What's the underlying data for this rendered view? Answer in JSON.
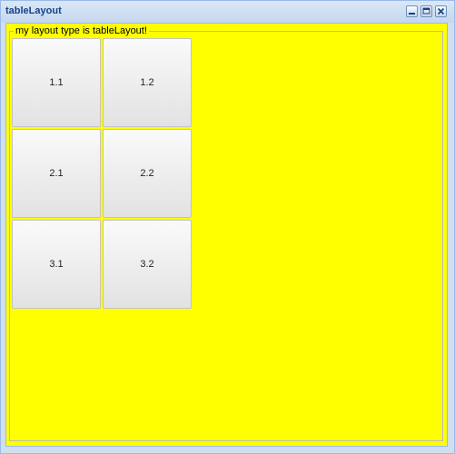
{
  "window": {
    "title": "tableLayout",
    "tools": {
      "minimize": "minimize-icon",
      "maximize": "maximize-icon",
      "close": "close-icon"
    }
  },
  "panel": {
    "legend": "my layout type is tableLayout!",
    "background_color": "#ffff00",
    "cells": [
      {
        "label": "1.1"
      },
      {
        "label": "1.2"
      },
      {
        "label": "2.1"
      },
      {
        "label": "2.2"
      },
      {
        "label": "3.1"
      },
      {
        "label": "3.2"
      }
    ]
  }
}
